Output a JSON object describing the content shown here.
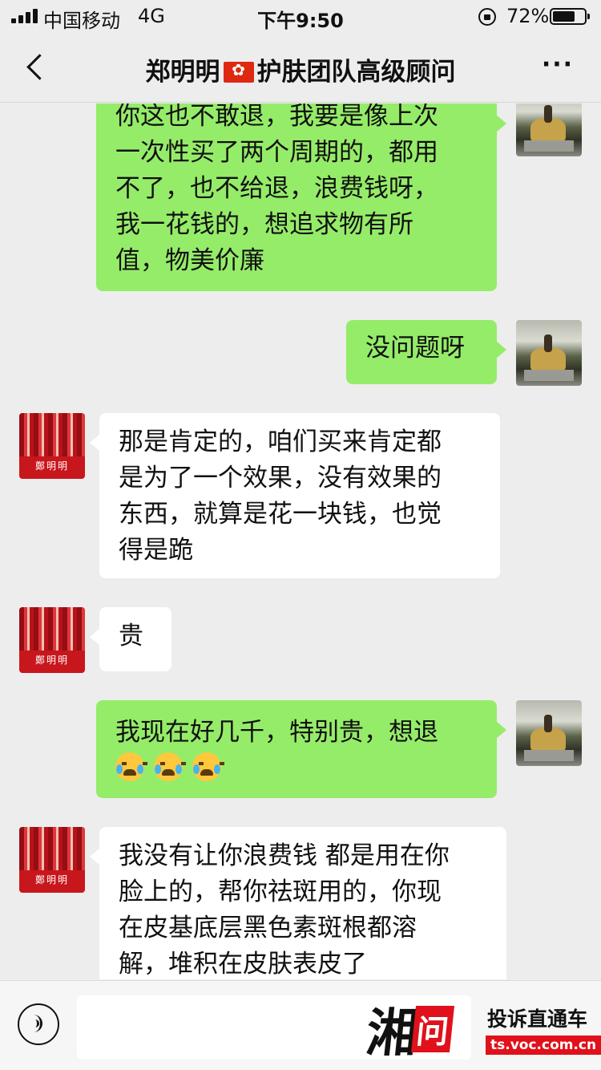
{
  "status_bar": {
    "carrier": "中国移动",
    "network": "4G",
    "time": "下午9:50",
    "battery_percent": "72%",
    "battery_level": 0.72
  },
  "header": {
    "contact_name": "郑明明",
    "contact_title": "护肤团队高级顾问",
    "more_label": "···"
  },
  "messages": [
    {
      "sender": "me",
      "lines": [
        "你这也不敢退，我要是像上次",
        "一次性买了两个周期的，都用",
        "不了，也不给退，浪费钱呀，",
        "我一花钱的，想追求物有所",
        "值，物美价廉"
      ]
    },
    {
      "sender": "me",
      "lines": [
        "没问题呀"
      ]
    },
    {
      "sender": "consultant",
      "lines": [
        "那是肯定的，咱们买来肯定都",
        "是为了一个效果，没有效果的",
        "东西，就算是花一块钱，也觉",
        "得是跪"
      ]
    },
    {
      "sender": "consultant",
      "lines": [
        "贵"
      ]
    },
    {
      "sender": "me",
      "lines": [
        "我现在好几千，特别贵，想退"
      ],
      "emojis": [
        "loudly-crying-emoji",
        "loudly-crying-emoji",
        "loudly-crying-emoji"
      ]
    },
    {
      "sender": "consultant",
      "lines": [
        "我没有让你浪费钱 都是用在你",
        "脸上的，帮你祛斑用的，你现",
        "在皮基底层黑色素斑根都溶",
        "解，堆积在皮肤表皮了"
      ]
    }
  ],
  "consultant_avatar_brand": "鄭明明",
  "watermark": {
    "logo_text": "湘问",
    "title": "投诉直通车",
    "url": "ts.voc.com.cn"
  },
  "colors": {
    "sent_bubble": "#95ec69",
    "received_bubble": "#ffffff",
    "background": "#ededed",
    "watermark_red": "#e0111a"
  },
  "icons": [
    "back-chevron-icon",
    "more-icon",
    "voice-icon",
    "signal-icon",
    "orientation-lock-icon",
    "battery-icon"
  ]
}
